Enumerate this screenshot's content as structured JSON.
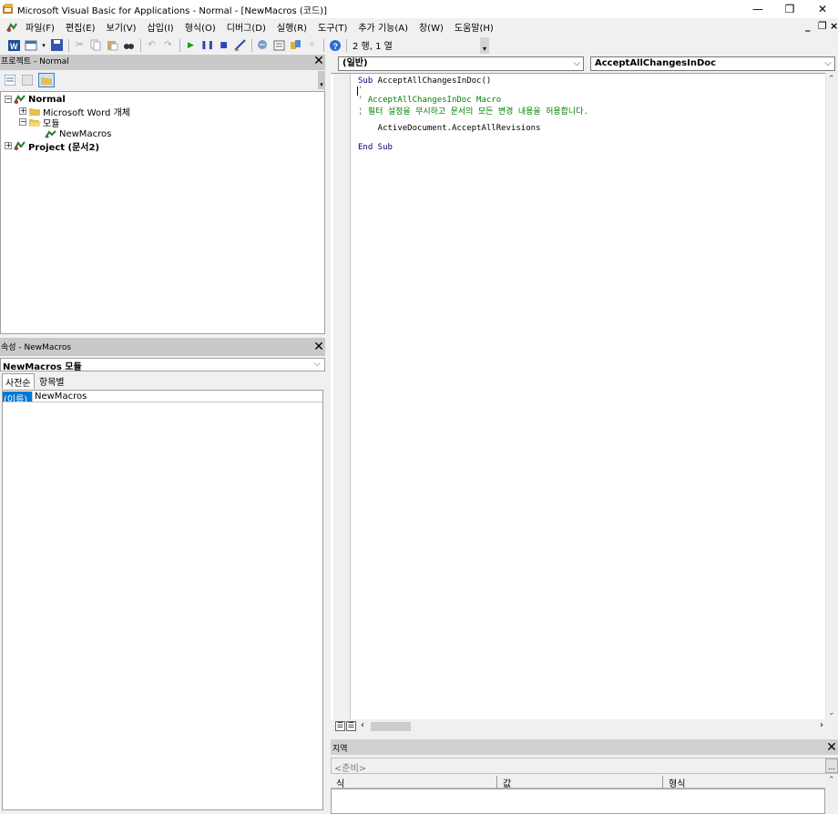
{
  "window": {
    "title": "Microsoft Visual Basic for Applications - Normal - [NewMacros (코드)]",
    "minimize_glyph": "—",
    "restore_glyph": "❐",
    "close_glyph": "✕",
    "mdi_minimize": "_",
    "mdi_restore": "❐",
    "mdi_close": "×"
  },
  "menubar": {
    "items": [
      "파일(F)",
      "편집(E)",
      "보기(V)",
      "삽입(I)",
      "형식(O)",
      "디버그(D)",
      "실행(R)",
      "도구(T)",
      "추가 기능(A)",
      "창(W)",
      "도움말(H)"
    ]
  },
  "toolbar": {
    "position_label": "2 행, 1 열"
  },
  "project_panel": {
    "title": "프로젝트 - Normal",
    "tree": {
      "normal": "Normal",
      "word_objects": "Microsoft Word 개체",
      "modules": "모듈",
      "newmacros": "NewMacros",
      "project2": "Project (문서2)"
    }
  },
  "properties_panel": {
    "title": "속성 - NewMacros",
    "object_selector": "NewMacros 모듈",
    "tabs": [
      "사전순",
      "항목별"
    ],
    "rows": [
      {
        "name": "(이름)",
        "value": "NewMacros"
      }
    ]
  },
  "code_window": {
    "object_combo": "(일반)",
    "procedure_combo": "AcceptAllChangesInDoc",
    "lines": {
      "sub_keyword": "Sub",
      "sub_name": " AcceptAllChangesInDoc()",
      "blank_comment": "'",
      "comment1": "' AcceptAllChangesInDoc Macro",
      "comment2": "' 필터 설정을 무시하고 문서의 모든 변경 내용을 허용합니다.",
      "comment3": "'",
      "statement": "    ActiveDocument.AcceptAllRevisions",
      "end_sub": "End Sub"
    }
  },
  "locals_panel": {
    "title": "지역",
    "status": "<준비>",
    "columns": [
      "식",
      "값",
      "형식"
    ]
  },
  "colors": {
    "keyword": "#00007f",
    "comment": "#008000",
    "selection": "#0078d7"
  }
}
